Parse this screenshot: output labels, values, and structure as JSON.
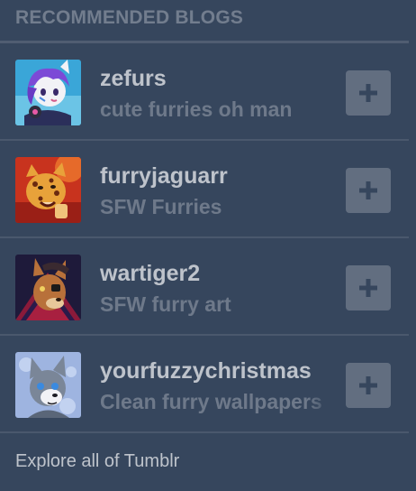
{
  "header": {
    "title": "RECOMMENDED BLOGS"
  },
  "blogs": [
    {
      "name": "zefurs",
      "description": "cute furries oh man",
      "avatar_icon": "purple-hair-fox-avatar",
      "follow_icon": "plus-icon"
    },
    {
      "name": "furryjaguarr",
      "description": "SFW Furries",
      "avatar_icon": "jaguar-avatar",
      "follow_icon": "plus-icon"
    },
    {
      "name": "wartiger2",
      "description": "SFW furry art",
      "avatar_icon": "eyepatch-wolf-avatar",
      "follow_icon": "plus-icon"
    },
    {
      "name": "yourfuzzychristmas",
      "description": "Clean furry wallpapers",
      "avatar_icon": "grey-wolf-avatar",
      "follow_icon": "plus-icon"
    }
  ],
  "footer": {
    "explore_label": "Explore all of Tumblr"
  },
  "colors": {
    "background": "#36465d"
  }
}
